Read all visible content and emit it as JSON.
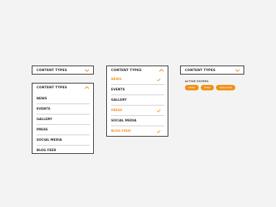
{
  "accent_color": "#f29018",
  "border_color": "#2a2a2a",
  "dropdown_collapsed": {
    "title": "CONTENT TYPES",
    "icon": "chevron-down-icon"
  },
  "dropdown_open": {
    "title": "CONTENT TYPES",
    "icon": "chevron-up-icon",
    "items": [
      {
        "label": "NEWS",
        "selected": false
      },
      {
        "label": "EVENTS",
        "selected": false
      },
      {
        "label": "GALLERY",
        "selected": false
      },
      {
        "label": "PRESS",
        "selected": false
      },
      {
        "label": "SOCIAL MEDIA",
        "selected": false
      },
      {
        "label": "BLOG FEED",
        "selected": false
      }
    ]
  },
  "dropdown_selected": {
    "title": "CONTENT TYPES",
    "icon": "chevron-up-icon",
    "items": [
      {
        "label": "NEWS",
        "selected": true
      },
      {
        "label": "EVENTS",
        "selected": false
      },
      {
        "label": "GALLERY",
        "selected": false
      },
      {
        "label": "PRESS",
        "selected": true
      },
      {
        "label": "SOCIAL MEDIA",
        "selected": false
      },
      {
        "label": "BLOG FEED",
        "selected": true
      }
    ]
  },
  "dropdown_filters": {
    "title": "CONTENT TYPES",
    "icon": "chevron-down-icon"
  },
  "active_filters": {
    "label": "ACTIVE FILTERS",
    "chips": [
      "News",
      "Press",
      "Blog Feed"
    ]
  }
}
